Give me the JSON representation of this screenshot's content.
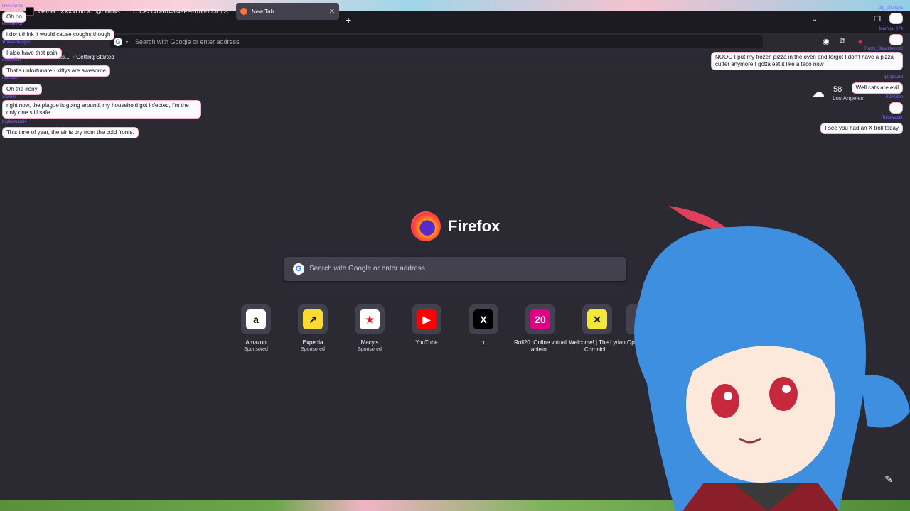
{
  "tabs": [
    {
      "label": "Gamer LXXXVI on X: \"@Leaflit",
      "favicon_color": "#000000"
    },
    {
      "label": "7CCF214D-8143-4FFF-8188-173CA",
      "favicon_color": "#42414d"
    },
    {
      "label": "New Tab",
      "favicon_color": "#ff7139",
      "active": true
    }
  ],
  "urlbar": {
    "placeholder": "Search with Google or enter address",
    "engine_glyph": "G"
  },
  "bookmarks": [
    {
      "label": "Import bookmarks..."
    },
    {
      "label": "Getting Started"
    }
  ],
  "brand": {
    "name": "Firefox"
  },
  "search": {
    "placeholder": "Search with Google or enter address",
    "engine_glyph": "G"
  },
  "shortcuts": [
    {
      "label": "Amazon",
      "sponsor": "Sponsored",
      "glyph": "a",
      "bg": "#ffffff",
      "fg": "#111111"
    },
    {
      "label": "Expedia",
      "sponsor": "Sponsored",
      "glyph": "↗",
      "bg": "#fddb32",
      "fg": "#111111"
    },
    {
      "label": "Macy's",
      "sponsor": "Sponsored",
      "glyph": "★",
      "bg": "#ffffff",
      "fg": "#e21a2c"
    },
    {
      "label": "YouTube",
      "sponsor": "",
      "glyph": "▶",
      "bg": "#ff0000",
      "fg": "#ffffff"
    },
    {
      "label": "x",
      "sponsor": "",
      "glyph": "X",
      "bg": "#000000",
      "fg": "#ffffff"
    },
    {
      "label": "Roll20: Online virtual tableto...",
      "sponsor": "",
      "glyph": "20",
      "bg": "#e10085",
      "fg": "#ffffff"
    },
    {
      "label": "Welcome! | The Lyrian Chronicl...",
      "sponsor": "",
      "glyph": "✕",
      "bg": "#f5e63c",
      "fg": "#111111"
    },
    {
      "label": "Open Pan",
      "sponsor": "",
      "glyph": "",
      "bg": "#42414d",
      "fg": "#ffffff"
    }
  ],
  "weather": {
    "temp": "58",
    "city": "Los Angeles"
  },
  "chat_left": [
    {
      "user": "DwerAmes",
      "text": "Oh no"
    },
    {
      "user": "koreanthor",
      "text": "i dont think it would cause coughs though"
    },
    {
      "user": "xthelastbadger",
      "text": "I also have that pain"
    },
    {
      "user": "daveofthe",
      "text": "That's unfortunate - kittys are awesome"
    },
    {
      "user": "realfarell",
      "text": "Oh the irony"
    },
    {
      "user": "3layme",
      "text": "right now, the plague is going around, my household got infected, I'm the only one still safe"
    },
    {
      "user": "bigfireman34",
      "text": "This time of year, the air is dry from the cold fronts."
    }
  ],
  "chat_right": [
    {
      "user": "big_chungus",
      "text": ""
    },
    {
      "user": "Mamba_674",
      "text": ""
    },
    {
      "user": "Rusty_Shackleford0",
      "text": "NOOO I put my frozen pizza in the oven and forgot I don't have a pizza cutter anymore I gotta eat it like a taco now"
    },
    {
      "user": "garyboard",
      "text": "Well cats are evil"
    },
    {
      "user": "SGI4Boo",
      "text": ""
    },
    {
      "user": "Tulcavaper",
      "text": "I see you had an X troll today"
    }
  ]
}
